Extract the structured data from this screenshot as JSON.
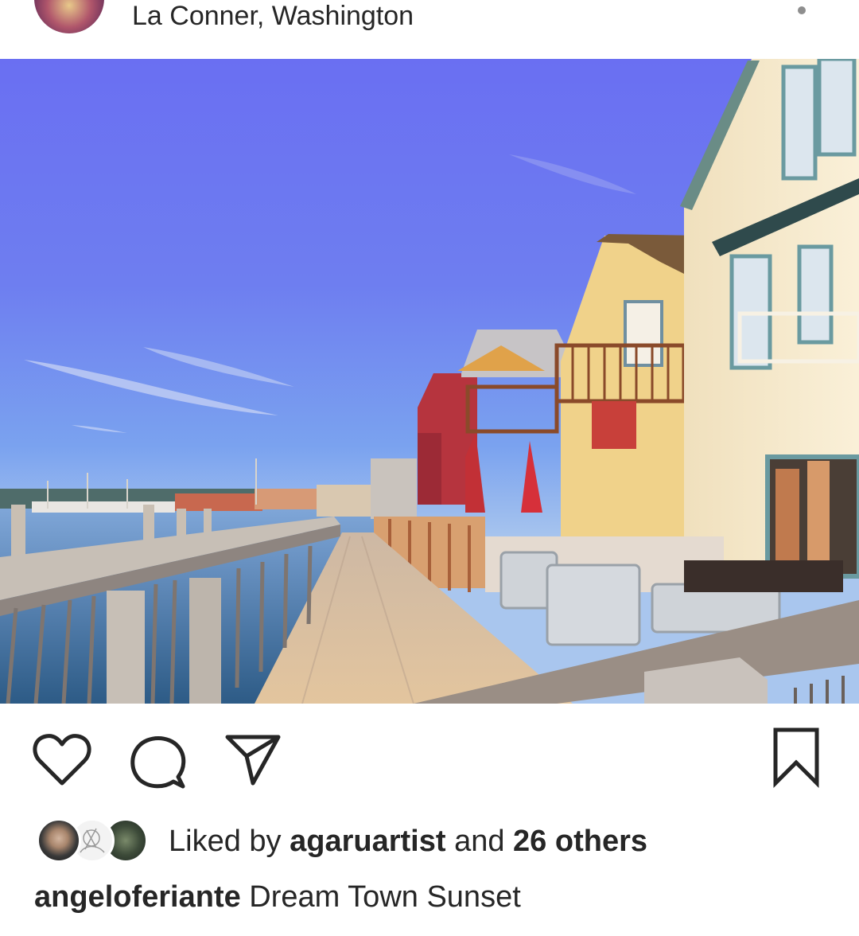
{
  "header": {
    "location": "La Conner, Washington",
    "avatar_icon": "profile-avatar",
    "more_icon": "more-options-icon"
  },
  "photo": {
    "icon": "post-photo"
  },
  "actions": {
    "like_icon": "heart-icon",
    "comment_icon": "comment-bubble-icon",
    "share_icon": "paper-plane-icon",
    "save_icon": "bookmark-icon"
  },
  "likes": {
    "prefix": "Liked by",
    "username": "agaruartist",
    "connector": "and",
    "others": "26 others"
  },
  "caption": {
    "username": "angeloferiante",
    "text": "Dream Town Sunset"
  },
  "colors": {
    "text": "#262626",
    "secondary": "#8e8e8e",
    "background": "#ffffff"
  }
}
